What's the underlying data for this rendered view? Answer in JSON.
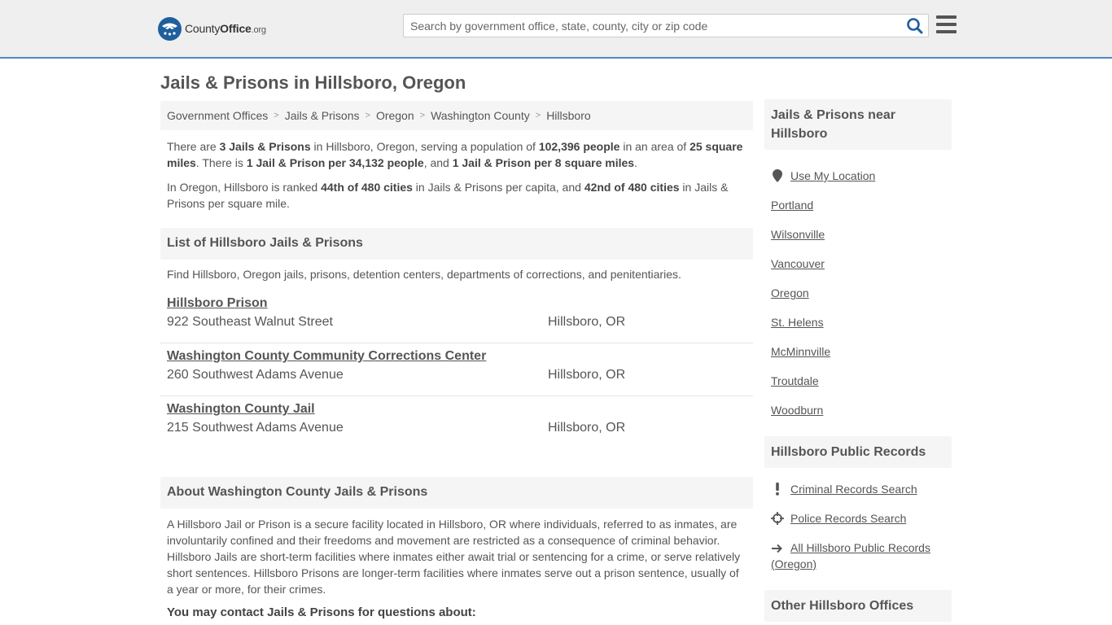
{
  "header": {
    "logo_text_main": "County",
    "logo_text_bold": "Office",
    "logo_text_tld": ".org",
    "search_placeholder": "Search by government office, state, county, city or zip code"
  },
  "page": {
    "title": "Jails & Prisons in Hillsboro, Oregon"
  },
  "breadcrumb": [
    "Government Offices",
    "Jails & Prisons",
    "Oregon",
    "Washington County",
    "Hillsboro"
  ],
  "summary": {
    "p1": {
      "t1": "There are ",
      "b1": "3 Jails & Prisons",
      "t2": " in Hillsboro, Oregon, serving a population of ",
      "b2": "102,396 people",
      "t3": " in an area of ",
      "b3": "25 square miles",
      "t4": ". There is ",
      "b4": "1 Jail & Prison per 34,132 people",
      "t5": ", and ",
      "b5": "1 Jail & Prison per 8 square miles",
      "t6": "."
    },
    "p2": {
      "t1": "In Oregon, Hillsboro is ranked ",
      "b1": "44th of 480 cities",
      "t2": " in Jails & Prisons per capita, and ",
      "b2": "42nd of 480 cities",
      "t3": " in Jails & Prisons per square mile."
    }
  },
  "list_section": {
    "title": "List of Hillsboro Jails & Prisons",
    "intro": "Find Hillsboro, Oregon jails, prisons, detention centers, departments of corrections, and penitentiaries.",
    "items": [
      {
        "name": "Hillsboro Prison",
        "address": "922 Southeast Walnut Street",
        "city": "Hillsboro, OR"
      },
      {
        "name": "Washington County Community Corrections Center",
        "address": "260 Southwest Adams Avenue",
        "city": "Hillsboro, OR"
      },
      {
        "name": "Washington County Jail",
        "address": "215 Southwest Adams Avenue",
        "city": "Hillsboro, OR"
      }
    ]
  },
  "about_section": {
    "title": "About Washington County Jails & Prisons",
    "text": "A Hillsboro Jail or Prison is a secure facility located in Hillsboro, OR where individuals, referred to as inmates, are involuntarily confined and their freedoms and movement are restricted as a consequence of criminal behavior. Hillsboro Jails are short-term facilities where inmates either await trial or sentencing for a crime, or serve relatively short sentences. Hillsboro Prisons are longer-term facilities where inmates serve out a prison sentence, usually of a year or more, for their crimes.",
    "contact_head": "You may contact Jails & Prisons for questions about:"
  },
  "sidebar": {
    "nearby": {
      "title": "Jails & Prisons near Hillsboro",
      "use_location": "Use My Location",
      "links": [
        "Portland",
        "Wilsonville",
        "Vancouver",
        "Oregon",
        "St. Helens",
        "McMinnville",
        "Troutdale",
        "Woodburn"
      ]
    },
    "records": {
      "title": "Hillsboro Public Records",
      "criminal": "Criminal Records Search",
      "police": "Police Records Search",
      "all": "All Hillsboro Public Records (Oregon)"
    },
    "other": {
      "title": "Other Hillsboro Offices"
    }
  },
  "colors": {
    "brand_blue": "#1f5f9e",
    "header_bg": "#efefef",
    "header_border": "#4a8ac4",
    "panel_bg": "#f5f5f5",
    "text": "#555555"
  }
}
